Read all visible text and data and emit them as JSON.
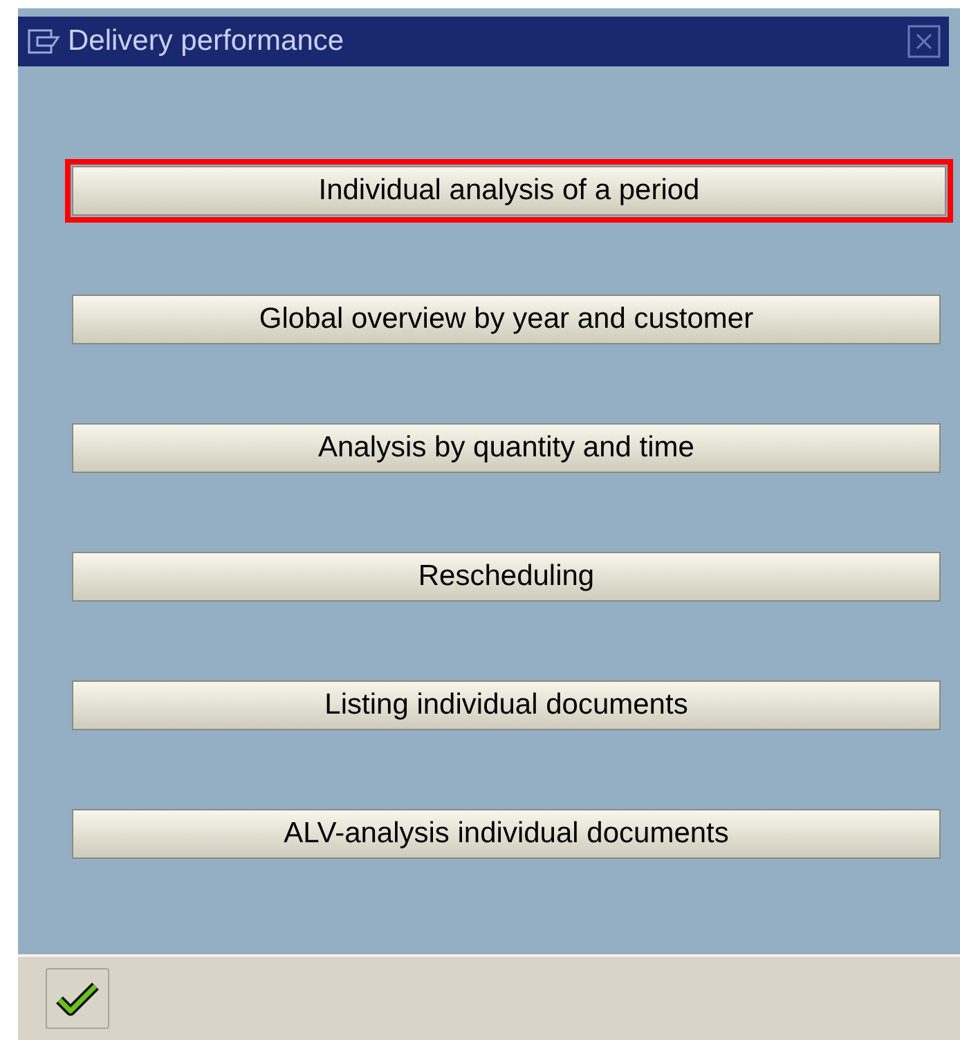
{
  "window": {
    "title": "Delivery performance"
  },
  "buttons": [
    {
      "label": "Individual analysis of a period",
      "highlighted": true
    },
    {
      "label": "Global overview by year and customer",
      "highlighted": false
    },
    {
      "label": "Analysis by quantity and time",
      "highlighted": false
    },
    {
      "label": "Rescheduling",
      "highlighted": false
    },
    {
      "label": "Listing individual documents",
      "highlighted": false
    },
    {
      "label": "ALV-analysis individual documents",
      "highlighted": false
    }
  ]
}
